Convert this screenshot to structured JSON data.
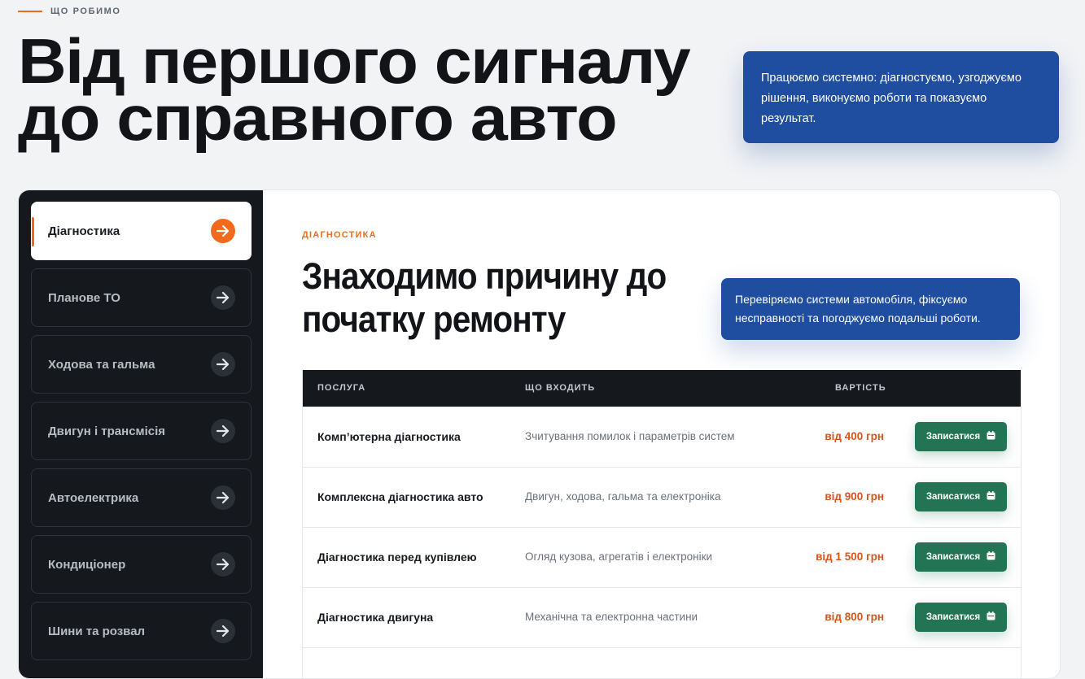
{
  "header": {
    "eyebrow": "ЩО РОБИМО",
    "title_line1": "Від першого сигналу",
    "title_line2": "до справного авто",
    "intro": "Працюємо системно: діагностуємо, узгоджуємо рішення, виконуємо роботи та показуємо результат."
  },
  "sidebar": {
    "items": [
      {
        "label": "Діагностика"
      },
      {
        "label": "Планове ТО"
      },
      {
        "label": "Ходова та гальма"
      },
      {
        "label": "Двигун і трансмісія"
      },
      {
        "label": "Автоелектрика"
      },
      {
        "label": "Кондиціонер"
      },
      {
        "label": "Шини та розвал"
      }
    ]
  },
  "section": {
    "label": "ДІАГНОСТИКА",
    "title_line1": "Знаходимо причину до",
    "title_line2": "початку ремонту",
    "note": "Перевіряємо системи автомобіля, фіксуємо несправності та погоджуємо подальші роботи."
  },
  "table": {
    "headers": {
      "service": "ПОСЛУГА",
      "includes": "ЩО ВХОДИТЬ",
      "price": "ВАРТІСТЬ"
    },
    "rows": [
      {
        "name": "Комп’ютерна діагностика",
        "desc": "Зчитування помилок і параметрів систем",
        "price": "від 400 грн",
        "button": "Записатися"
      },
      {
        "name": "Комплексна діагностика авто",
        "desc": "Двигун, ходова, гальма та електроніка",
        "price": "від 900 грн",
        "button": "Записатися"
      },
      {
        "name": "Діагностика перед купівлею",
        "desc": "Огляд кузова, агрегатів і електроніки",
        "price": "від 1 500 грн",
        "button": "Записатися"
      },
      {
        "name": "Діагностика двигуна",
        "desc": "Механічна та електронна частини",
        "price": "від 800 грн",
        "button": "Записатися"
      }
    ]
  },
  "colors": {
    "accent": "#f26a1b",
    "brand_blue": "#1f4ea0",
    "sidebar_dark": "#15181d",
    "button_green": "#237454",
    "price_orange": "#d9531a"
  },
  "icons": {
    "arrow": "arrow-right-icon",
    "calendar": "calendar-icon"
  }
}
